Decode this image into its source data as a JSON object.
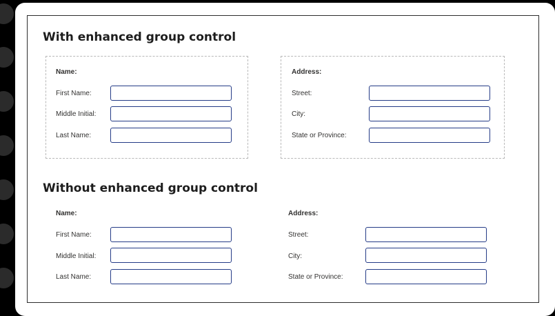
{
  "enhanced": {
    "title": "With enhanced group control",
    "name_group": {
      "heading": "Name:",
      "fields": [
        {
          "label": "First Name:",
          "value": ""
        },
        {
          "label": "Middle Initial:",
          "value": ""
        },
        {
          "label": "Last Name:",
          "value": ""
        }
      ]
    },
    "address_group": {
      "heading": "Address:",
      "fields": [
        {
          "label": "Street:",
          "value": ""
        },
        {
          "label": "City:",
          "value": ""
        },
        {
          "label": "State or Province:",
          "value": ""
        }
      ]
    }
  },
  "plain": {
    "title": "Without enhanced group control",
    "name_group": {
      "heading": "Name:",
      "fields": [
        {
          "label": "First Name:",
          "value": ""
        },
        {
          "label": "Middle Initial:",
          "value": ""
        },
        {
          "label": "Last Name:",
          "value": ""
        }
      ]
    },
    "address_group": {
      "heading": "Address:",
      "fields": [
        {
          "label": "Street:",
          "value": ""
        },
        {
          "label": "City:",
          "value": ""
        },
        {
          "label": "State or Province:",
          "value": ""
        }
      ]
    }
  }
}
